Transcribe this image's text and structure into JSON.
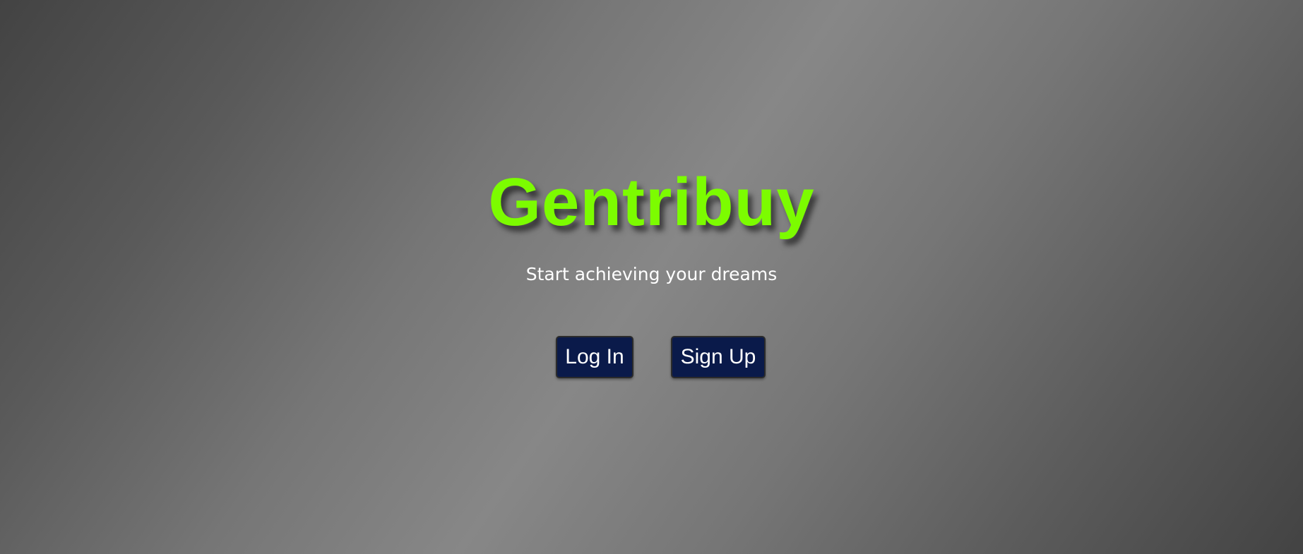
{
  "hero": {
    "brand": "Gentribuy",
    "tagline": "Start achieving your dreams"
  },
  "actions": {
    "login_label": "Log In",
    "signup_label": "Sign Up"
  },
  "colors": {
    "brand": "#7cfc00",
    "button_bg": "#0a1a4a",
    "text": "#ffffff"
  }
}
